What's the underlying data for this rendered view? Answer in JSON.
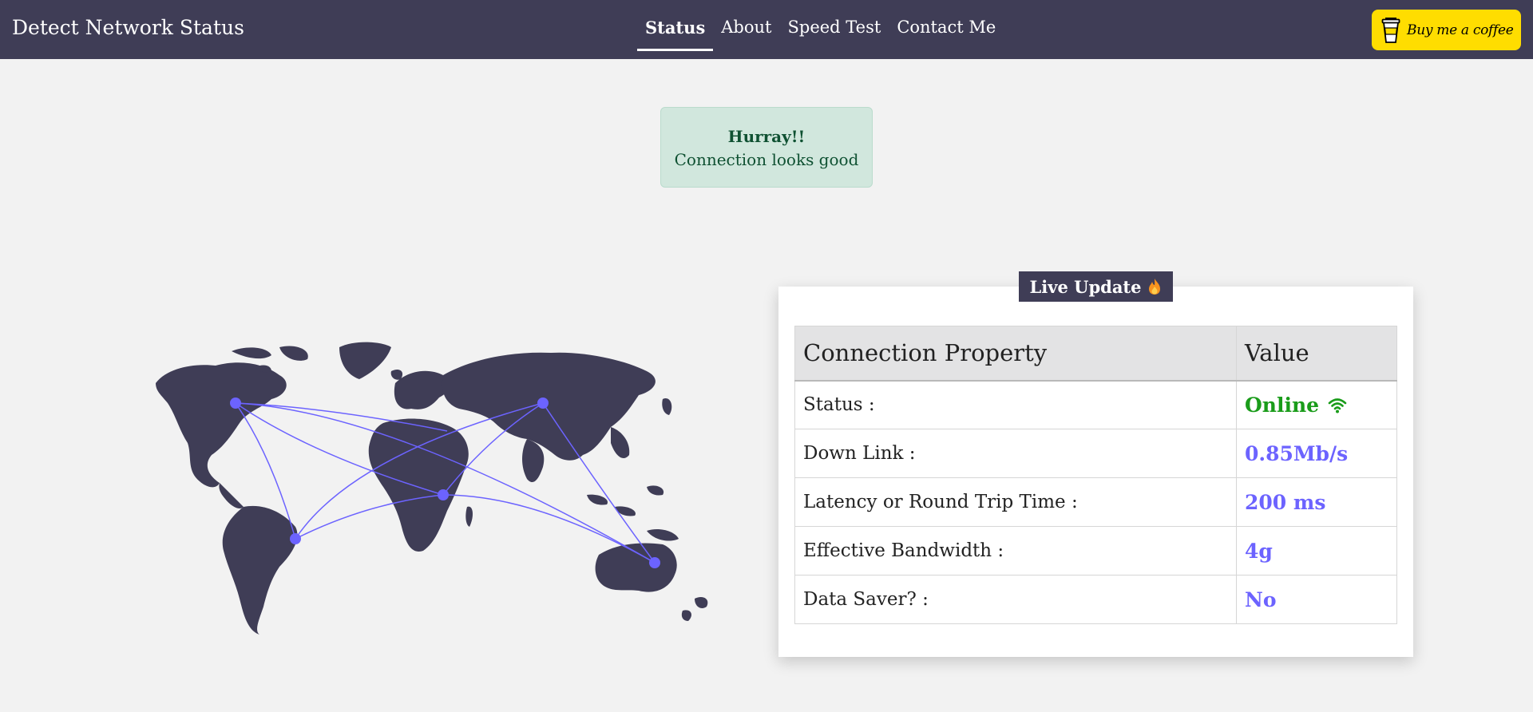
{
  "navbar": {
    "brand": "Detect Network Status",
    "links": [
      "Status",
      "About",
      "Speed Test",
      "Contact Me"
    ],
    "active_link": "Status",
    "coffee_label": "Buy me a coffee"
  },
  "alert": {
    "title": "Hurray!!",
    "text": "Connection looks good"
  },
  "live_update": {
    "badge": "Live Update",
    "icon": "fire-icon"
  },
  "table": {
    "headers": [
      "Connection Property",
      "Value"
    ],
    "rows": [
      {
        "property": "Status :",
        "value": "Online",
        "icon": "wifi-icon",
        "color": "#1a9c1a"
      },
      {
        "property": "Down Link :",
        "value": "0.85Mb/s",
        "color": "#6c63ff"
      },
      {
        "property": "Latency or Round Trip Time :",
        "value": "200 ms",
        "color": "#6c63ff"
      },
      {
        "property": "Effective Bandwidth :",
        "value": "4g",
        "color": "#6c63ff"
      },
      {
        "property": "Data Saver? :",
        "value": "No",
        "color": "#6c63ff"
      }
    ]
  },
  "colors": {
    "navbar": "#3f3d56",
    "accent": "#6c63ff",
    "coffee": "#ffdd00",
    "alert_bg": "#d1e7dd"
  }
}
